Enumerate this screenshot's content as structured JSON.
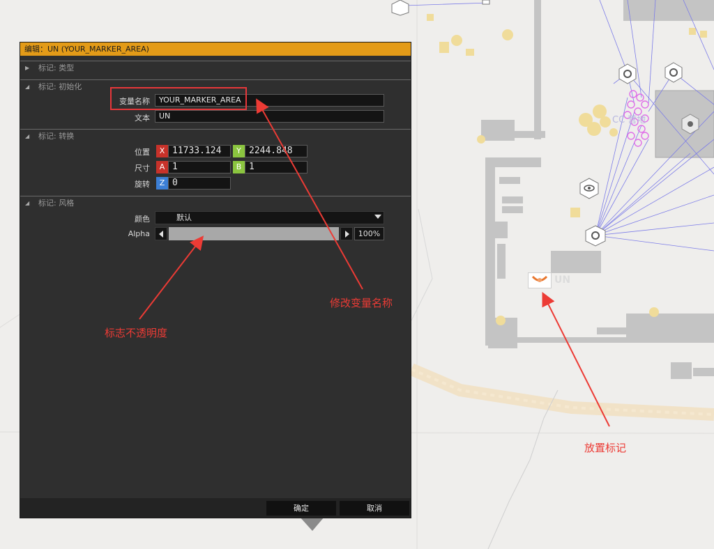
{
  "dialog": {
    "title": "编辑：UN (YOUR_MARKER_AREA)",
    "sections": {
      "type": "标记: 类型",
      "init": "标记: 初始化",
      "transform": "标记: 转换",
      "style": "标记: 风格"
    },
    "fields": {
      "variable_name_label": "变量名称",
      "variable_name_value": "YOUR_MARKER_AREA",
      "text_label": "文本",
      "text_value": "UN",
      "position_label": "位置",
      "position_x_axis": "X",
      "position_x": "11733.124",
      "position_y_axis": "Y",
      "position_y": "2244.848",
      "size_label": "尺寸",
      "size_a_axis": "A",
      "size_a": "1",
      "size_b_axis": "B",
      "size_b": "1",
      "rotation_label": "旋转",
      "rotation_z_axis": "Z",
      "rotation_z": "0",
      "color_label": "颜色",
      "color_value": "默认",
      "alpha_label": "Alpha",
      "alpha_value": "100%",
      "alpha_fraction": 1.0
    },
    "buttons": {
      "ok": "确定",
      "cancel": "取消"
    }
  },
  "annotations": {
    "opacity": "标志不透明度",
    "rename": "修改变量名称",
    "place": "放置标记"
  },
  "map": {
    "marker_label": "UN",
    "marker_icon": "un-emblem-icon"
  },
  "colors": {
    "accent": "#e39b18",
    "annotation": "#ec3b35",
    "axis_red": "#c8322a",
    "axis_green": "#8bc53f",
    "axis_blue": "#3c7fd6"
  }
}
